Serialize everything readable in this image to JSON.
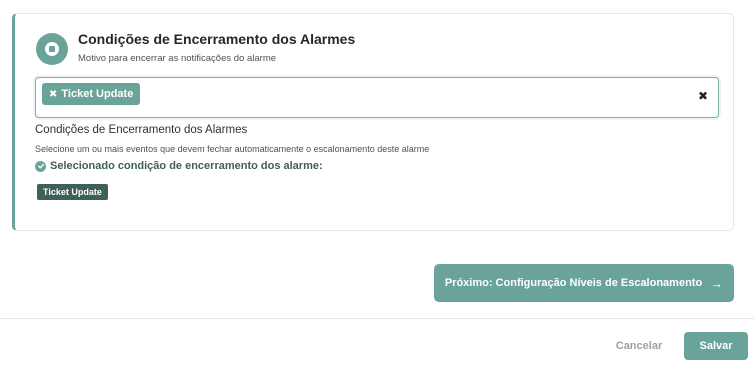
{
  "card": {
    "title": "Condições de Encerramento dos Alarmes",
    "subtitle": "Motivo para encerrar as notificações do alarme",
    "icon": "stop-circle-icon"
  },
  "select": {
    "chips": [
      {
        "label": "Ticket Update",
        "remove_symbol": "✖"
      }
    ],
    "clear_symbol": "✖"
  },
  "section": {
    "title": "Condições de Encerramento dos Alarmes",
    "description": "Selecione um ou mais eventos que devem fechar automaticamente o escalonamento deste alarme",
    "selected_label": "Selecionado condição de encerramento dos alarme:",
    "selected_tags": [
      "Ticket Update"
    ]
  },
  "buttons": {
    "next_label": "Próximo: Configuração Níveis de Escalonamento",
    "next_arrow": "→",
    "cancel_label": "Cancelar",
    "save_label": "Salvar"
  },
  "colors": {
    "accent": "#6aa39a",
    "accent_dark": "#3e5f5a",
    "text_dark": "#22292c",
    "muted": "#9ba3a6"
  }
}
